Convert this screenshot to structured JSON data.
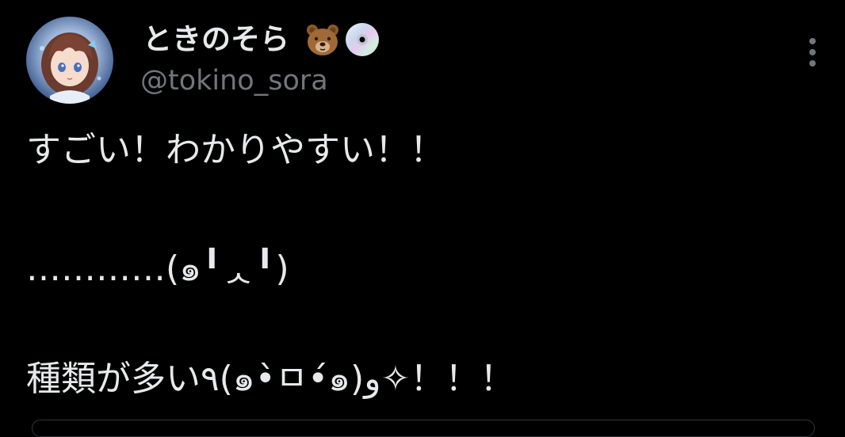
{
  "tweet": {
    "display_name": "ときのそら",
    "name_emojis": [
      "bear-face-icon",
      "optical-disc-icon"
    ],
    "handle": "@tokino_sora",
    "body_lines": [
      "すごい！わかりやすい！！",
      "…………(๑╹ᆺ╹)",
      "種類が多い٩(๑•̀ㅁ•́๑)و✧！！！"
    ]
  },
  "colors": {
    "background": "#000000",
    "text_primary": "#e7e9ea",
    "text_secondary": "#71767b",
    "border": "#2f3336"
  }
}
